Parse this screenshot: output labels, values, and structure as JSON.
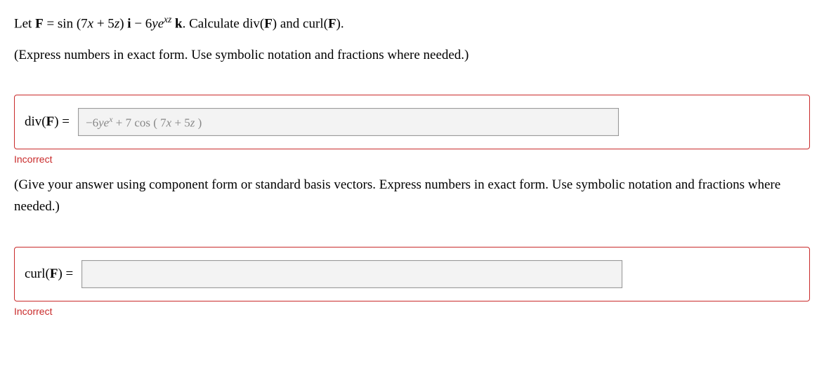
{
  "problem": {
    "prefix": "Let ",
    "vector_name": "F",
    "equals": " = sin (7",
    "x1": "x",
    "plus5": " + 5",
    "z1": "z",
    "close_i": ") ",
    "i_vec": "i",
    "minus": " − 6",
    "y1": "y",
    "e": "e",
    "exp": "xz",
    "space": " ",
    "k_vec": "k",
    "period": ". Calculate div(",
    "F2": "F",
    "and": ") and curl(",
    "F3": "F",
    "end": ")."
  },
  "instructions1": "(Express numbers in exact form. Use symbolic notation and fractions where needed.)",
  "answer1": {
    "label_pre": "div(",
    "label_F": "F",
    "label_post": ") =",
    "value_neg6": "−6",
    "value_y": "y",
    "value_e": "e",
    "value_exp": "x",
    "value_plus7": " + 7 cos ( 7",
    "value_x": "x",
    "value_plus5": " + 5",
    "value_z": "z",
    "value_close": " )"
  },
  "incorrect": "Incorrect",
  "instructions2": "(Give your answer using component form or standard basis vectors. Express numbers in exact form. Use symbolic notation and fractions where needed.)",
  "answer2": {
    "label_pre": "curl(",
    "label_F": "F",
    "label_post": ") =",
    "value": ""
  }
}
